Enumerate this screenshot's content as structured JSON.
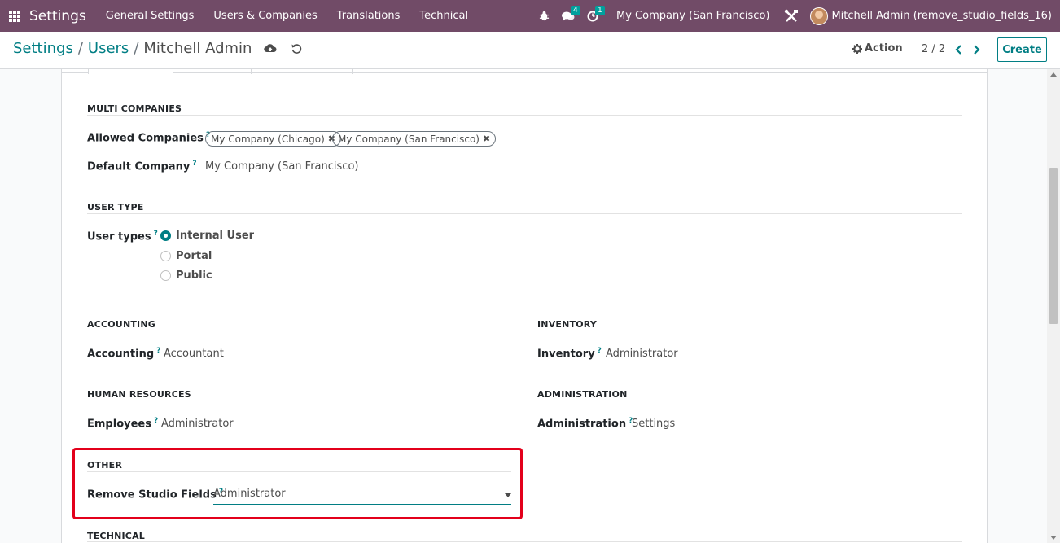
{
  "navbar": {
    "brand": "Settings",
    "menu": [
      "General Settings",
      "Users & Companies",
      "Translations",
      "Technical"
    ],
    "messages_badge": "4",
    "activity_badge": "1",
    "company": "My Company (San Francisco)",
    "user": "Mitchell Admin (remove_studio_fields_16)"
  },
  "control_panel": {
    "breadcrumb": [
      "Settings",
      "Users",
      "Mitchell Admin"
    ],
    "separator": "/",
    "action_label": "Action",
    "pager": "2 / 2",
    "create_label": "Create"
  },
  "form": {
    "multi_companies": {
      "title": "MULTI COMPANIES",
      "allowed_label": "Allowed Companies",
      "allowed_tags": [
        "My Company (Chicago)",
        "My Company (San Francisco)"
      ],
      "default_label": "Default Company",
      "default_value": "My Company (San Francisco)"
    },
    "user_type": {
      "title": "USER TYPE",
      "label": "User types",
      "options": [
        "Internal User",
        "Portal",
        "Public"
      ],
      "selected": "Internal User"
    },
    "accounting": {
      "title": "ACCOUNTING",
      "label": "Accounting",
      "value": "Accountant"
    },
    "inventory": {
      "title": "INVENTORY",
      "label": "Inventory",
      "value": "Administrator"
    },
    "human_resources": {
      "title": "HUMAN RESOURCES",
      "label": "Employees",
      "value": "Administrator"
    },
    "administration": {
      "title": "ADMINISTRATION",
      "label": "Administration",
      "value": "Settings"
    },
    "other": {
      "title": "OTHER",
      "label": "Remove Studio Fields",
      "value": "Administrator"
    },
    "technical": {
      "title": "TECHNICAL"
    },
    "help_mark": "?"
  },
  "colors": {
    "navbar": "#714b67",
    "accent": "#017e84",
    "highlight": "#e3001b",
    "badge": "#00a09d"
  }
}
